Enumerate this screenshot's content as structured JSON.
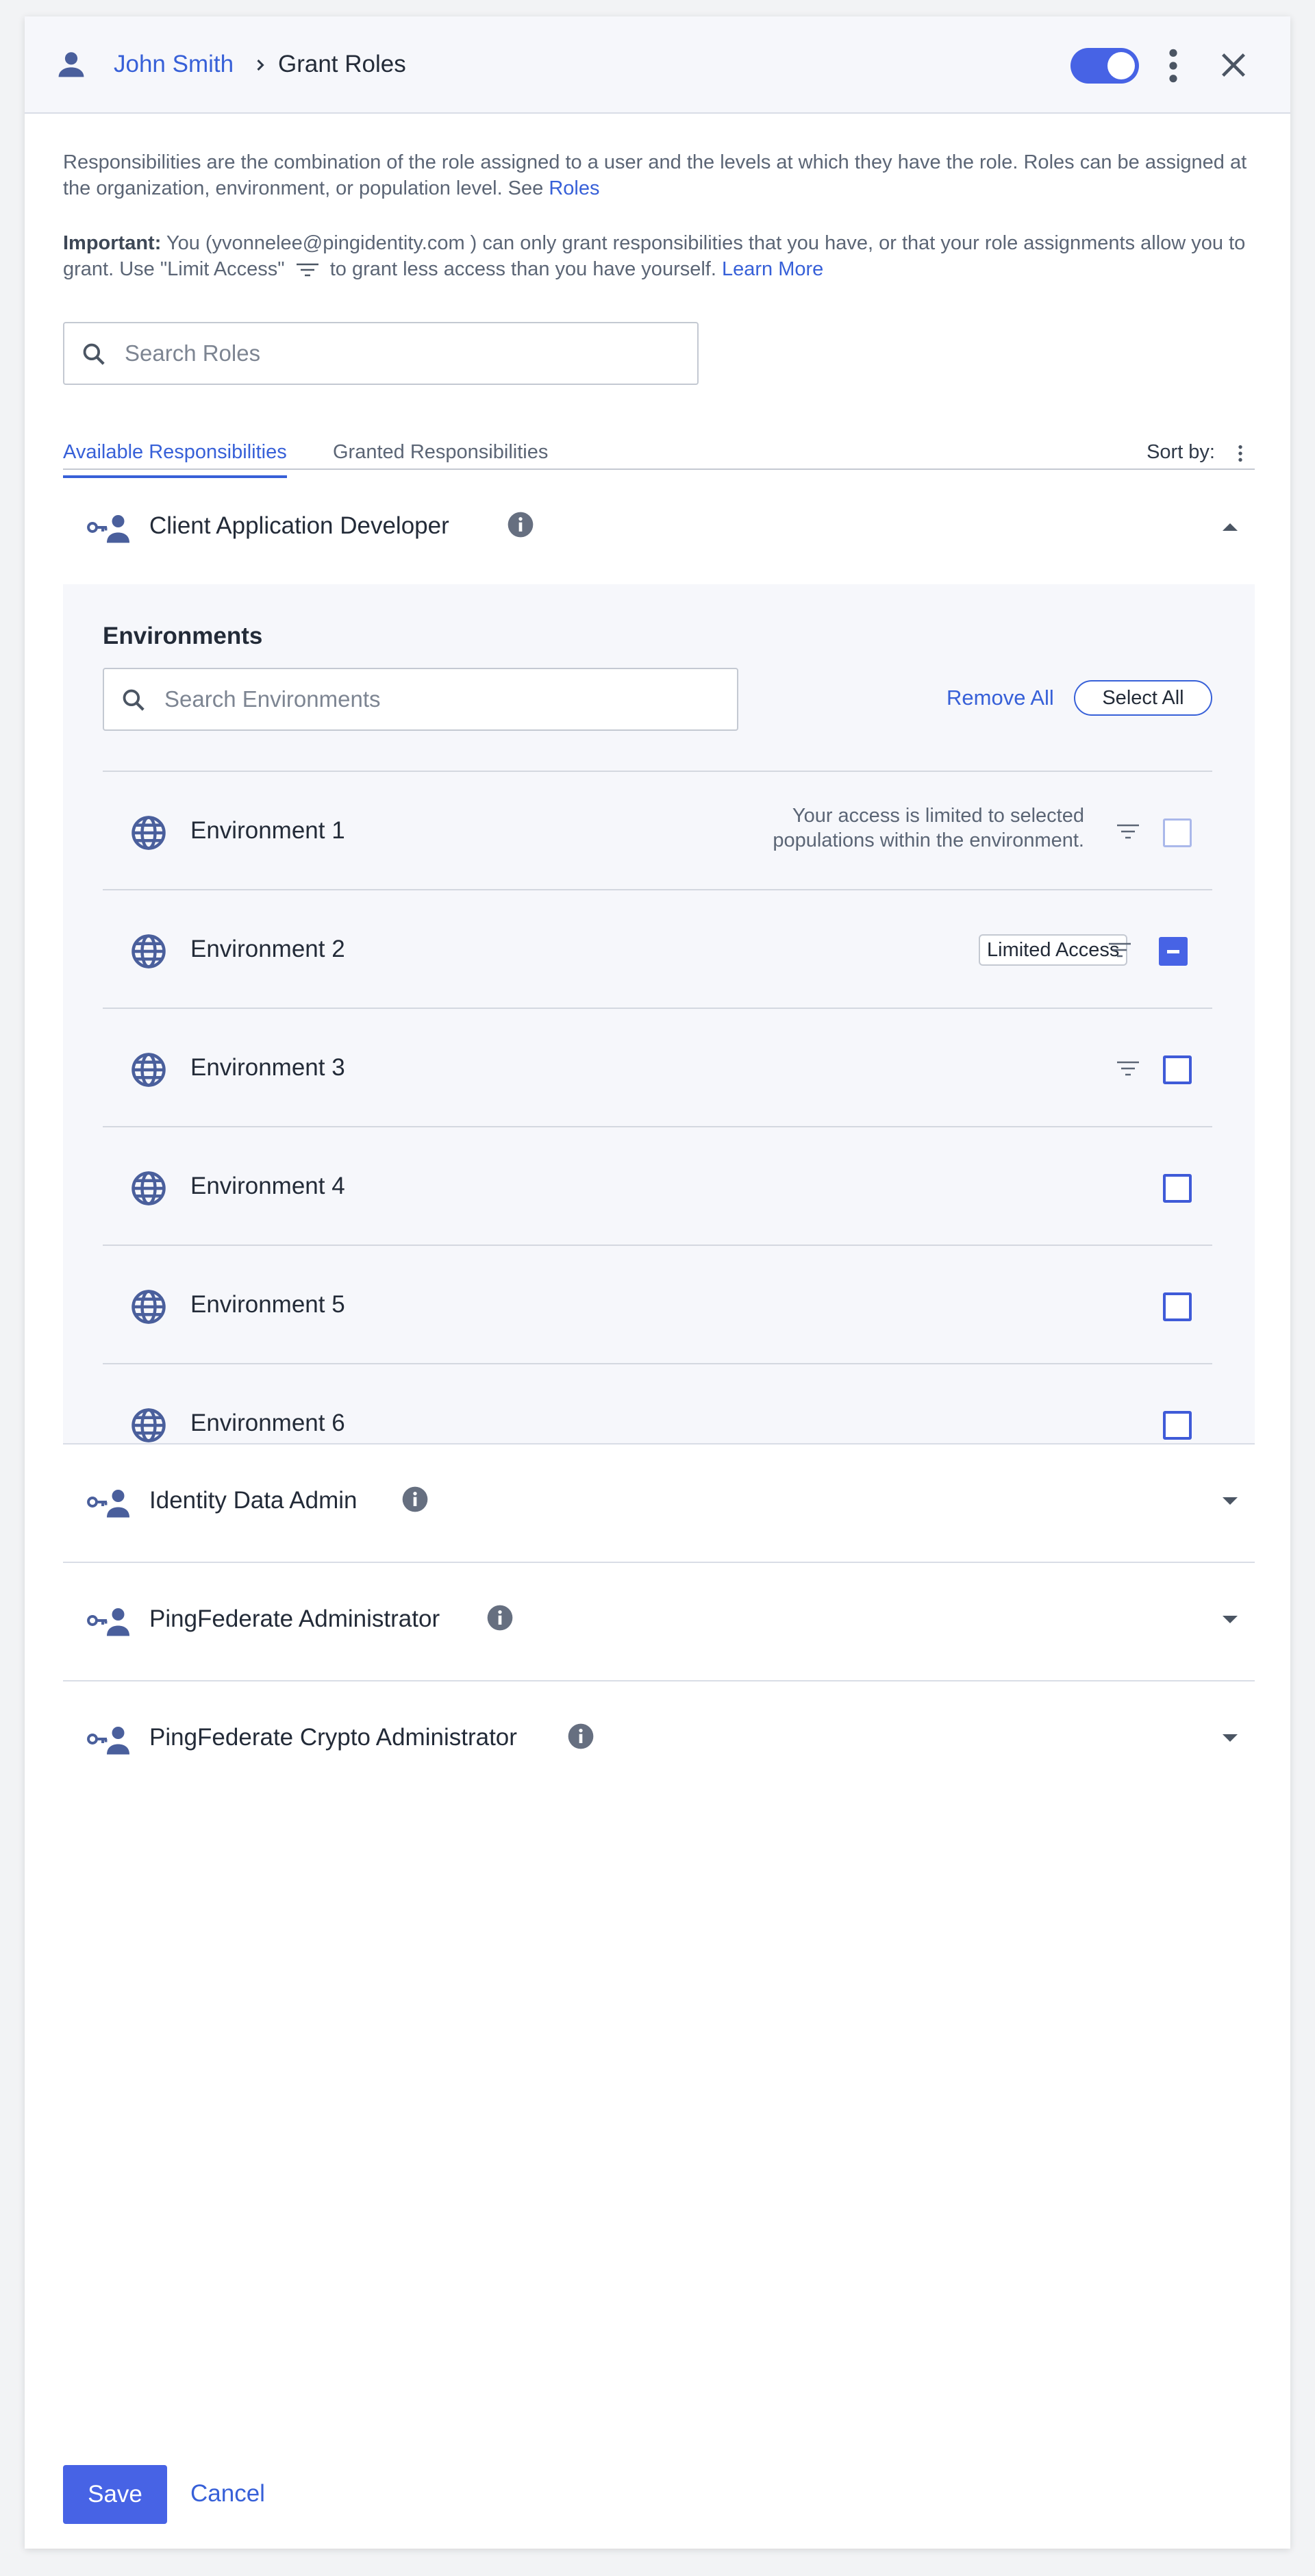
{
  "header": {
    "user_name": "John Smith",
    "title": "Grant Roles",
    "icons": {
      "user": "person-icon",
      "separator": "chevron-right-icon",
      "menu": "kebab-icon",
      "close": "close-icon"
    },
    "toggle_on": true
  },
  "intro": {
    "text": "Responsibilities are the combination of the role assigned to a user and the levels at which they have the role. Roles can be assigned at the organization, environment, or population level. See ",
    "link": "Roles"
  },
  "important": {
    "label": "Important:",
    "text_before": " You (yvonnelee@pingidentity.com ) can only grant responsibilities that you have, or that your role assignments allow you to grant. Use \"Limit Access\" ",
    "text_after": " to grant less access than you have yourself. ",
    "link": "Learn More"
  },
  "search": {
    "placeholder": "Search Roles",
    "value": ""
  },
  "tabs": [
    {
      "label": "Available Responsibilities",
      "active": true
    },
    {
      "label": "Granted Responsibilities",
      "active": false
    }
  ],
  "sort": {
    "label": "Sort by:"
  },
  "roles": [
    {
      "name": "Client Application Developer",
      "expanded": true
    },
    {
      "name": "Identity Data Admin",
      "expanded": false
    },
    {
      "name": "PingFederate Administrator",
      "expanded": false
    },
    {
      "name": "PingFederate Crypto Administrator",
      "expanded": false
    }
  ],
  "environments": {
    "heading": "Environments",
    "search_placeholder": "Search Environments",
    "remove_all": "Remove All",
    "select_all": "Select All",
    "limited_note": "Your access is limited to selected populations within the environment.",
    "limited_badge": "Limited Access",
    "items": [
      {
        "name": "Environment 1",
        "state": "disabled"
      },
      {
        "name": "Environment 2",
        "state": "indeterminate"
      },
      {
        "name": "Environment 3",
        "state": "unchecked"
      },
      {
        "name": "Environment 4",
        "state": "unchecked"
      },
      {
        "name": "Environment 5",
        "state": "unchecked"
      },
      {
        "name": "Environment 6",
        "state": "unchecked"
      }
    ]
  },
  "footer": {
    "save": "Save",
    "cancel": "Cancel"
  },
  "colors": {
    "accent": "#4763e5",
    "link": "#3760d8",
    "header_bg": "#f6f7fb",
    "icon": "#4a5f9c"
  }
}
